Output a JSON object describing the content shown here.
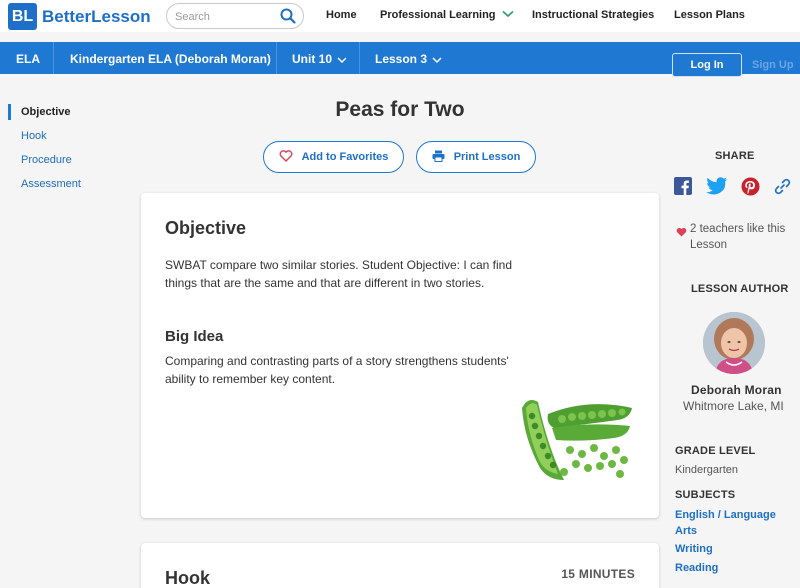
{
  "brand": {
    "logo_mark": "BL",
    "name": "BetterLesson",
    "color": "#1e6fc7"
  },
  "search": {
    "placeholder": "Search"
  },
  "topnav": {
    "home": "Home",
    "professional_learning": "Professional Learning",
    "instructional_strategies": "Instructional Strategies",
    "lesson_plans": "Lesson Plans"
  },
  "breadcrumb": {
    "subject": "ELA",
    "course": "Kindergarten ELA (Deborah Moran)",
    "unit": "Unit 10",
    "lesson": "Lesson 3"
  },
  "auth": {
    "login": "Log In",
    "signup": "Sign Up"
  },
  "sidenav": [
    "Objective",
    "Hook",
    "Procedure",
    "Assessment"
  ],
  "lesson": {
    "title": "Peas for Two",
    "favorites_label": "Add to Favorites",
    "print_label": "Print Lesson"
  },
  "objective": {
    "heading": "Objective",
    "text": "SWBAT compare two similar stories.  Student Objective: I can find things that are the same and that are different in two stories.",
    "big_idea_heading": "Big Idea",
    "big_idea_text": "Comparing and contrasting parts of a story strengthens students' ability to remember key content."
  },
  "hook": {
    "heading": "Hook",
    "minutes": "15 MINUTES"
  },
  "sidebar": {
    "share_heading": "SHARE",
    "likes_text": "2 teachers like this Lesson",
    "author_heading": "LESSON AUTHOR",
    "author_name": "Deborah Moran",
    "author_location": "Whitmore Lake, MI",
    "grade_heading": "GRADE LEVEL",
    "grade": "Kindergarten",
    "subjects_heading": "SUBJECTS",
    "subjects": [
      "English / Language Arts",
      "Writing",
      "Reading"
    ]
  },
  "colors": {
    "accent": "#1f78d1",
    "heart": "#e0415a",
    "facebook": "#3b5998",
    "twitter": "#1da1f2",
    "pinterest": "#c8232c"
  }
}
